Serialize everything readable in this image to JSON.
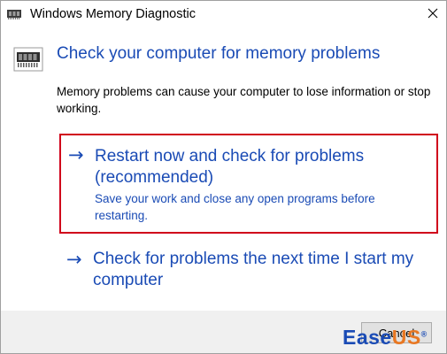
{
  "window": {
    "title": "Windows Memory Diagnostic"
  },
  "header": {
    "heading": "Check your computer for memory problems",
    "description": "Memory problems can cause your computer to lose information or stop working."
  },
  "options": [
    {
      "arrow": "→",
      "title": "Restart now and check for problems (recommended)",
      "subtitle": "Save your work and close any open programs before restarting."
    },
    {
      "arrow": "→",
      "title": "Check for problems the next time I start my computer"
    }
  ],
  "footer": {
    "cancel_label": "Cancel"
  },
  "watermark": {
    "part1": "Ease",
    "part2": "US",
    "reg": "®"
  },
  "colors": {
    "link_blue": "#1a4bb5",
    "highlight_red": "#d0021b",
    "brand_orange": "#e87722"
  },
  "icons": {
    "app": "memory-chip-icon",
    "close": "close-icon",
    "header": "memory-chip-icon",
    "option_arrow": "right-arrow-icon"
  }
}
